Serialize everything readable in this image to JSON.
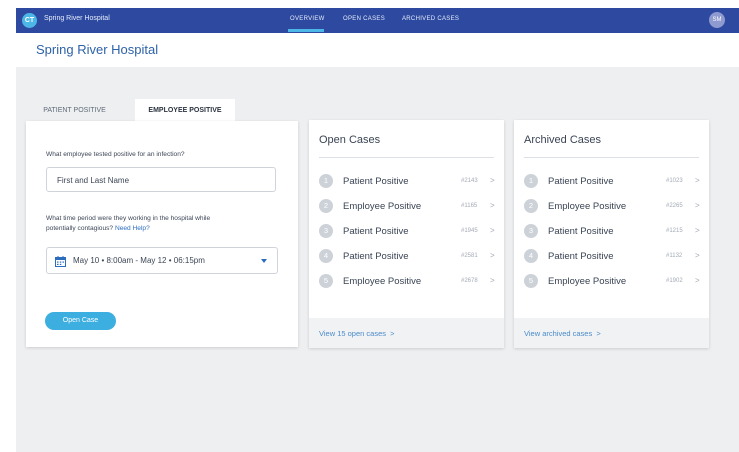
{
  "topbar": {
    "logo_text": "CT",
    "app_name": "Spring River Hospital",
    "nav": [
      "OVERVIEW",
      "OPEN CASES",
      "ARCHIVED CASES"
    ],
    "active_nav": "OVERVIEW",
    "avatar_initials": "SM"
  },
  "header": {
    "title": "Spring River Hospital"
  },
  "tabs": [
    "PATIENT POSITIVE",
    "EMPLOYEE POSITIVE"
  ],
  "active_tab": "EMPLOYEE POSITIVE",
  "form": {
    "question1": "What employee tested positive for an infection?",
    "name_placeholder": "First and Last Name",
    "question2_line1": "What time period were they working in the hospital while",
    "question2_line2": "potentially contagious?",
    "help_link": "Need Help?",
    "date_range": "May 10 • 8:00am - May 12 • 06:15pm",
    "submit_label": "Open Case"
  },
  "open_cases": {
    "title": "Open Cases",
    "items": [
      {
        "num": "1",
        "label": "Patient Positive",
        "id": "#2143"
      },
      {
        "num": "2",
        "label": "Employee Positive",
        "id": "#1165"
      },
      {
        "num": "3",
        "label": "Patient Positive",
        "id": "#1945"
      },
      {
        "num": "4",
        "label": "Patient Positive",
        "id": "#2581"
      },
      {
        "num": "5",
        "label": "Employee Positive",
        "id": "#2678"
      }
    ],
    "footer_link": "View 15 open cases"
  },
  "archived_cases": {
    "title": "Archived Cases",
    "items": [
      {
        "num": "1",
        "label": "Patient Positive",
        "id": "#1023"
      },
      {
        "num": "2",
        "label": "Employee Positive",
        "id": "#2265"
      },
      {
        "num": "3",
        "label": "Patient Positive",
        "id": "#1215"
      },
      {
        "num": "4",
        "label": "Patient Positive",
        "id": "#1132"
      },
      {
        "num": "5",
        "label": "Employee Positive",
        "id": "#1902"
      }
    ],
    "footer_link": "View archived cases"
  },
  "icons": {
    "chevron": ">",
    "calendar": "calendar-icon",
    "dropdown": "caret-down-icon"
  },
  "colors": {
    "topbar": "#2d4aa0",
    "accent": "#3daee0",
    "title": "#2e62a8",
    "link": "#4a8bc9"
  }
}
